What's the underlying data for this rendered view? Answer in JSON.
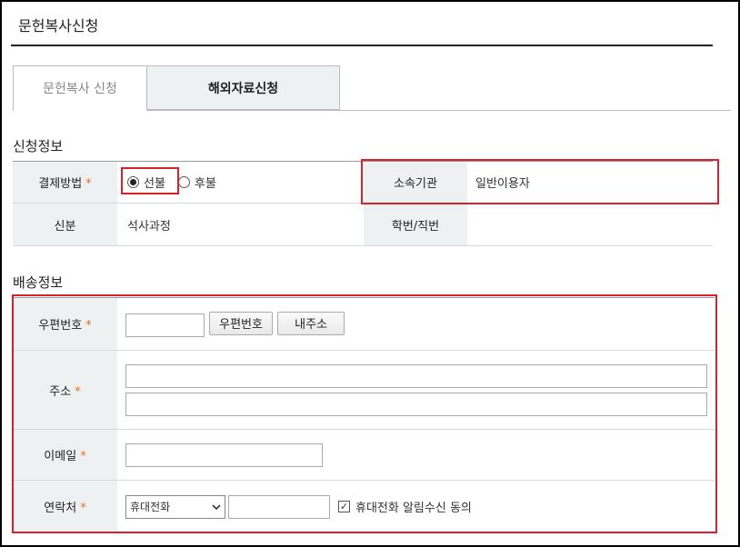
{
  "page": {
    "title": "문헌복사신청"
  },
  "tabs": [
    {
      "label": "문헌복사 신청",
      "active": true
    },
    {
      "label": "해외자료신청",
      "active": false
    }
  ],
  "apply_info": {
    "section_title": "신청정보",
    "payment_label": "결제방법",
    "payment_options": [
      "선불",
      "후불"
    ],
    "payment_selected": "선불",
    "affiliation_label": "소속기관",
    "affiliation_value": "일반이용자",
    "status_label": "신분",
    "status_value": "석사과정",
    "id_label": "학번/직번",
    "id_value": ""
  },
  "delivery_info": {
    "section_title": "배송정보",
    "postcode_label": "우편번호",
    "postcode_button": "우편번호",
    "my_address_button": "내주소",
    "address_label": "주소",
    "email_label": "이메일",
    "contact_label": "연락처",
    "phone_type_selected": "휴대전화",
    "sms_consent_label": "휴대전화 알림수신 동의",
    "sms_consent_checked": true
  },
  "required_mark": "*",
  "colors": {
    "required": "#f26a21",
    "highlight": "#d9202b",
    "header_bg": "#eef1f2"
  }
}
